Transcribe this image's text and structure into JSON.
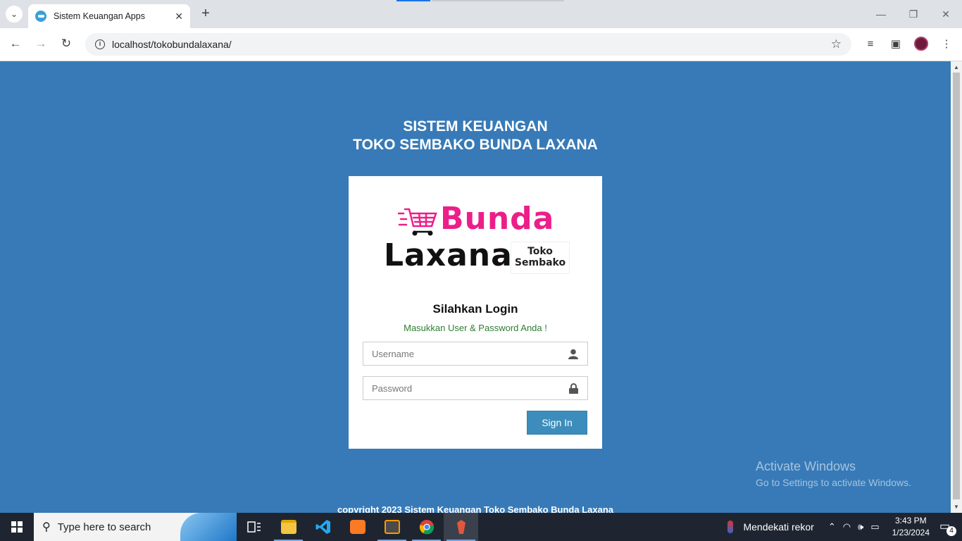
{
  "browser": {
    "tab_title": "Sistem Keuangan Apps",
    "url": "localhost/tokobundalaxana/"
  },
  "page": {
    "title_line1": "SISTEM KEUANGAN",
    "title_line2": "TOKO SEMBAKO BUNDA LAXANA",
    "logo": {
      "word1": "Bunda",
      "word2": "Laxana",
      "tag1": "Toko",
      "tag2": "Sembako"
    },
    "login_heading": "Silahkan Login",
    "login_sub": "Masukkan User & Password Anda !",
    "username_placeholder": "Username",
    "password_placeholder": "Password",
    "signin_label": "Sign In",
    "copyright": "copyright 2023 Sistem Keuangan Toko Sembako Bunda Laxana",
    "colors": {
      "background": "#377ab7",
      "button": "#3c8dbc",
      "logo_pink": "#ec1e8a",
      "subtext_green": "#2e7d32"
    }
  },
  "watermark": {
    "line1": "Activate Windows",
    "line2": "Go to Settings to activate Windows."
  },
  "taskbar": {
    "search_placeholder": "Type here to search",
    "weather": "Mendekati rekor",
    "time": "3:43 PM",
    "date": "1/23/2024",
    "notification_count": "4"
  }
}
